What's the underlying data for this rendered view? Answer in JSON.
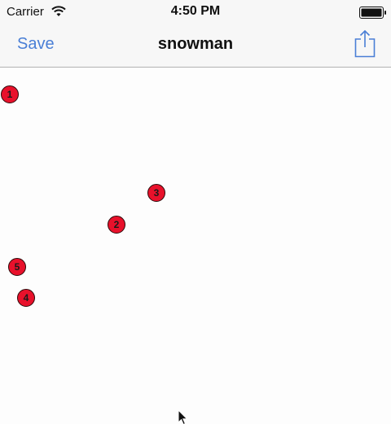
{
  "status_bar": {
    "carrier": "Carrier",
    "time": "4:50 PM"
  },
  "nav_bar": {
    "save_label": "Save",
    "title": "snowman",
    "share_icon": "share-icon"
  },
  "points": [
    {
      "label": "1"
    },
    {
      "label": "3"
    },
    {
      "label": "2"
    },
    {
      "label": "5"
    },
    {
      "label": "4"
    }
  ],
  "colors": {
    "accent": "#4a7fd6",
    "marker_fill": "#e8112b",
    "marker_stroke": "#2a0a0a"
  }
}
